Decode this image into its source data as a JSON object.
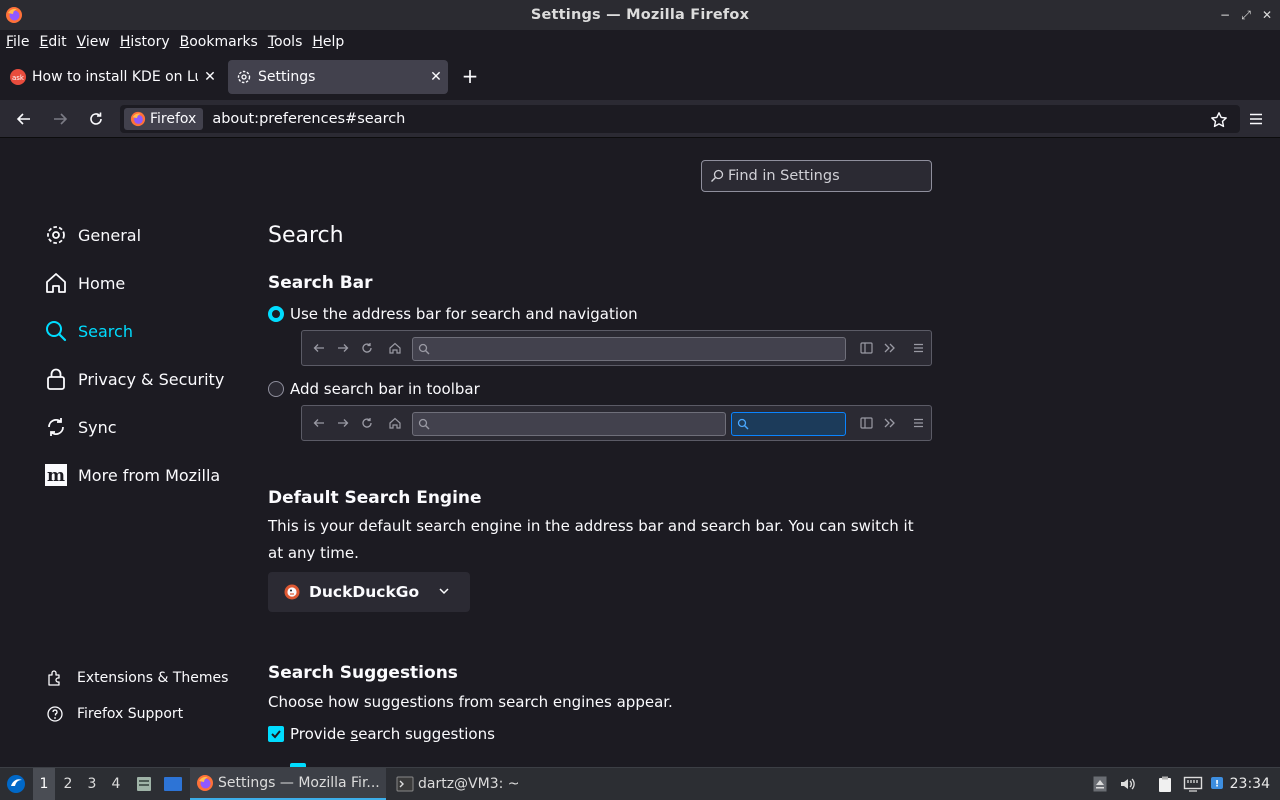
{
  "window": {
    "title": "Settings — Mozilla Firefox",
    "controls": {
      "minimize": "−",
      "maximize": "⤢",
      "close": "✕"
    }
  },
  "menubar": {
    "items": [
      {
        "label": "File",
        "accel": "F",
        "rest": "ile"
      },
      {
        "label": "Edit",
        "accel": "E",
        "rest": "dit"
      },
      {
        "label": "View",
        "accel": "V",
        "rest": "iew"
      },
      {
        "label": "History",
        "accel": "H",
        "rest": "istory"
      },
      {
        "label": "Bookmarks",
        "accel": "B",
        "rest": "ookmarks"
      },
      {
        "label": "Tools",
        "accel": "T",
        "rest": "ools"
      },
      {
        "label": "Help",
        "accel": "H",
        "rest": "elp"
      }
    ]
  },
  "tabs": [
    {
      "label": "How to install KDE on Lubuntu",
      "favicon": "ask-icon",
      "close": "✕",
      "active": false
    },
    {
      "label": "Settings",
      "favicon": "gear-icon",
      "close": "✕",
      "active": true
    }
  ],
  "newtab": "+",
  "navbar": {
    "identity_label": "Firefox",
    "url": "about:preferences#search"
  },
  "find": {
    "placeholder": "Find in Settings"
  },
  "categories": [
    {
      "label": "General",
      "icon": "gear-icon",
      "selected": false
    },
    {
      "label": "Home",
      "icon": "home-icon",
      "selected": false
    },
    {
      "label": "Search",
      "icon": "search-icon",
      "selected": true
    },
    {
      "label": "Privacy & Security",
      "icon": "lock-icon",
      "selected": false
    },
    {
      "label": "Sync",
      "icon": "sync-icon",
      "selected": false
    },
    {
      "label": "More from Mozilla",
      "icon": "mozilla-icon",
      "selected": false
    }
  ],
  "footer_links": [
    {
      "label": "Extensions & Themes",
      "icon": "puzzle-icon"
    },
    {
      "label": "Firefox Support",
      "icon": "help-icon"
    }
  ],
  "page": {
    "heading": "Search",
    "search_bar": {
      "heading": "Search Bar",
      "option_address": "Use the address bar for search and navigation",
      "option_toolbar": "Add search bar in toolbar",
      "selected": "address"
    },
    "default_engine": {
      "heading": "Default Search Engine",
      "description_1": "This is your default search engine in the address bar and search bar. You can switch it",
      "description_2": "at any time.",
      "selected": "DuckDuckGo"
    },
    "suggestions": {
      "heading": "Search Suggestions",
      "description": "Choose how suggestions from search engines appear.",
      "provide_pre": "Provide ",
      "provide_accel": "s",
      "provide_post": "earch suggestions",
      "provide_checked": true
    }
  },
  "taskbar": {
    "workspaces": [
      "1",
      "2",
      "3",
      "4"
    ],
    "active_workspace": "1",
    "tasks": [
      {
        "label": "Settings — Mozilla Fir...",
        "icon": "firefox-icon",
        "active": true
      },
      {
        "label": "dartz@VM3: ~",
        "icon": "terminal-icon",
        "active": false
      }
    ],
    "clock": "23:34"
  },
  "colors": {
    "accent": "#00ddff",
    "background": "#1c1b22",
    "toolbar": "#2b2a33"
  }
}
